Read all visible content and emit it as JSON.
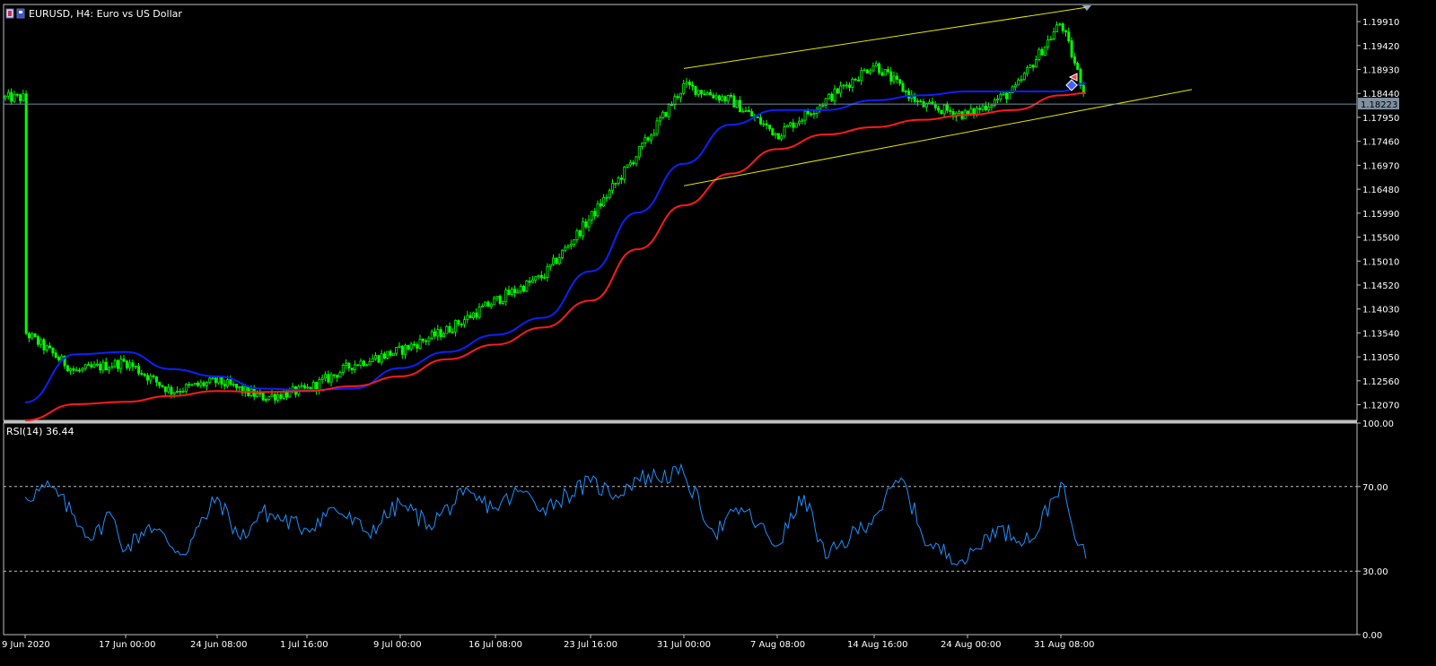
{
  "header": {
    "symbol_title": "EURUSD, H4:  Euro vs US Dollar"
  },
  "colors": {
    "background": "#000000",
    "axis": "#c0c0c0",
    "text": "#ffffff",
    "candle": "#00ff00",
    "ma_fast": "#0a22ff",
    "ma_slow": "#ff1a1a",
    "channel": "#e6e600",
    "rsi": "#1e90ff",
    "price_line": "#7090a0"
  },
  "chart_data": [
    {
      "type": "candlestick",
      "title": "EURUSD, H4:  Euro vs US Dollar",
      "ylim": [
        1.1175,
        1.2026
      ],
      "x_tick_labels": [
        "9 Jun 2020",
        "17 Jun 00:00",
        "24 Jun 08:00",
        "1 Jul 16:00",
        "9 Jul 00:00",
        "16 Jul 08:00",
        "23 Jul 16:00",
        "31 Jul 00:00",
        "7 Aug 08:00",
        "14 Aug 16:00",
        "24 Aug 00:00",
        "31 Aug 08:00"
      ],
      "y_ticks": [
        "1.19910",
        "1.19420",
        "1.18930",
        "1.18440",
        "1.17950",
        "1.17460",
        "1.16970",
        "1.16480",
        "1.15990",
        "1.15500",
        "1.15010",
        "1.14520",
        "1.14030",
        "1.13540",
        "1.13050",
        "1.12560",
        "1.12070"
      ],
      "current_price": "1.18223",
      "series": [
        {
          "name": "EURUSD close",
          "x": [
            "9 Jun 2020",
            "12 Jun",
            "17 Jun 00:00",
            "20 Jun",
            "24 Jun 08:00",
            "28 Jun",
            "1 Jul 16:00",
            "5 Jul",
            "9 Jul 00:00",
            "12 Jul",
            "16 Jul 08:00",
            "20 Jul",
            "23 Jul 16:00",
            "27 Jul",
            "31 Jul 00:00",
            "3 Aug",
            "7 Aug 08:00",
            "11 Aug",
            "14 Aug 16:00",
            "19 Aug",
            "24 Aug 00:00",
            "27 Aug",
            "31 Aug 08:00",
            "2 Sep"
          ],
          "values": [
            1.1355,
            1.1275,
            1.1295,
            1.1235,
            1.1255,
            1.1222,
            1.1238,
            1.129,
            1.1318,
            1.136,
            1.142,
            1.147,
            1.159,
            1.172,
            1.186,
            1.183,
            1.176,
            1.183,
            1.1905,
            1.182,
            1.18,
            1.185,
            1.199,
            1.1835
          ]
        },
        {
          "name": "MA fast",
          "x": [
            "9 Jun 2020",
            "12 Jun",
            "17 Jun 00:00",
            "20 Jun",
            "24 Jun 08:00",
            "28 Jun",
            "1 Jul 16:00",
            "5 Jul",
            "9 Jul 00:00",
            "12 Jul",
            "16 Jul 08:00",
            "20 Jul",
            "23 Jul 16:00",
            "27 Jul",
            "31 Jul 00:00",
            "3 Aug",
            "7 Aug 08:00",
            "11 Aug",
            "14 Aug 16:00",
            "19 Aug",
            "24 Aug 00:00",
            "27 Aug",
            "31 Aug 08:00",
            "2 Sep"
          ],
          "values": [
            1.1212,
            1.131,
            1.1315,
            1.128,
            1.1265,
            1.124,
            1.1237,
            1.124,
            1.1282,
            1.1315,
            1.135,
            1.1385,
            1.148,
            1.16,
            1.17,
            1.178,
            1.181,
            1.181,
            1.183,
            1.184,
            1.1848,
            1.1848,
            1.1848,
            1.1865
          ]
        },
        {
          "name": "MA slow",
          "x": [
            "9 Jun 2020",
            "12 Jun",
            "17 Jun 00:00",
            "20 Jun",
            "24 Jun 08:00",
            "28 Jun",
            "1 Jul 16:00",
            "5 Jul",
            "9 Jul 00:00",
            "12 Jul",
            "16 Jul 08:00",
            "20 Jul",
            "23 Jul 16:00",
            "27 Jul",
            "31 Jul 00:00",
            "3 Aug",
            "7 Aug 08:00",
            "11 Aug",
            "14 Aug 16:00",
            "19 Aug",
            "24 Aug 00:00",
            "27 Aug",
            "31 Aug 08:00",
            "2 Sep"
          ],
          "values": [
            1.1175,
            1.1208,
            1.1213,
            1.1225,
            1.1235,
            1.1233,
            1.1235,
            1.1245,
            1.1265,
            1.13,
            1.133,
            1.1365,
            1.142,
            1.1525,
            1.1615,
            1.168,
            1.173,
            1.176,
            1.1775,
            1.179,
            1.18,
            1.181,
            1.184,
            1.1845
          ]
        },
        {
          "name": "Channel upper",
          "x": [
            "31 Jul 00:00",
            "2 Sep"
          ],
          "values": [
            1.1895,
            1.202
          ]
        },
        {
          "name": "Channel lower",
          "x": [
            "31 Jul 00:00",
            "6 Sep"
          ],
          "values": [
            1.1655,
            1.1852
          ]
        }
      ]
    },
    {
      "type": "line",
      "title": "RSI(14) 36.44",
      "ylim": [
        0,
        100
      ],
      "y_ticks": [
        "100.00",
        "70.00",
        "30.00",
        "0.00"
      ],
      "levels": [
        70,
        30
      ],
      "series": [
        {
          "name": "RSI(14)",
          "x": [
            "9 Jun 2020",
            "11 Jun",
            "13 Jun",
            "15 Jun",
            "17 Jun 00:00",
            "19 Jun",
            "21 Jun",
            "24 Jun 08:00",
            "26 Jun",
            "28 Jun",
            "1 Jul 16:00",
            "4 Jul",
            "6 Jul",
            "9 Jul 00:00",
            "11 Jul",
            "13 Jul",
            "16 Jul 08:00",
            "18 Jul",
            "20 Jul",
            "23 Jul 16:00",
            "25 Jul",
            "27 Jul",
            "31 Jul 00:00",
            "2 Aug",
            "4 Aug",
            "7 Aug 08:00",
            "9 Aug",
            "11 Aug",
            "14 Aug 16:00",
            "17 Aug",
            "20 Aug",
            "24 Aug 00:00",
            "26 Aug",
            "28 Aug",
            "31 Aug 08:00",
            "1 Sep",
            "2 Sep"
          ],
          "values": [
            65,
            70,
            45,
            58,
            40,
            52,
            38,
            65,
            45,
            58,
            50,
            60,
            48,
            62,
            52,
            66,
            60,
            68,
            60,
            72,
            66,
            74,
            76,
            48,
            60,
            42,
            66,
            36,
            56,
            74,
            42,
            35,
            50,
            45,
            72,
            45,
            36
          ]
        }
      ]
    }
  ]
}
